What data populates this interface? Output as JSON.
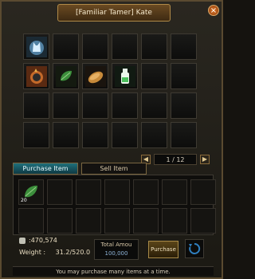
{
  "window": {
    "title": "[Familiar Tamer] Kate",
    "close_glyph": "×"
  },
  "shop": {
    "items": [
      {
        "name": "blue-aura-cat-item-icon"
      },
      {
        "name": "red-fox-guardian-item-icon"
      },
      {
        "name": "green-leaf-item-icon"
      },
      {
        "name": "bread-item-icon"
      },
      {
        "name": "green-bottle-item-icon"
      }
    ],
    "pager": {
      "prev": "◀",
      "text": "1 / 12",
      "next": "▶"
    }
  },
  "tabs": {
    "purchase": "Purchase Item",
    "sell": "Sell Item"
  },
  "purchase_slot": {
    "qty": "20"
  },
  "footer": {
    "money": ":470,574",
    "weight_label": "Weight :",
    "weight_value": "31.2/520.0",
    "total_label": "Total Amou",
    "total_value": "100,000",
    "purchase_button": "Purchase",
    "status": "You may purchase many items at a time."
  },
  "colors": {
    "accent": "#1f6f7a",
    "border": "#3e3a32"
  }
}
